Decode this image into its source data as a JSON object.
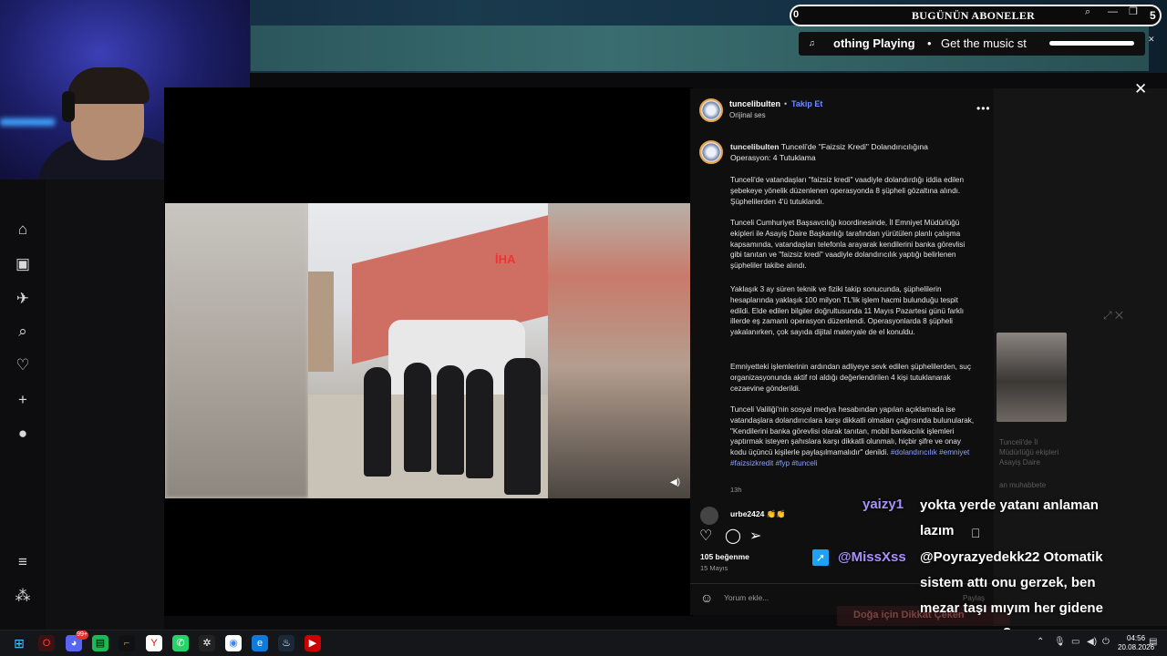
{
  "overlay": {
    "subs_label": "BUGÜNÜN ABONELER",
    "subs_count": "0",
    "subs_right": "5",
    "now_playing": "othing Playing",
    "now_playing_marquee": "Get the music st",
    "np_bullet": "•"
  },
  "post": {
    "username": "tuncelibulten",
    "follow": "Takip Et",
    "audio": "Orijinal ses",
    "caption_user": "tuncelibulten",
    "caption_title": "Tunceli'de \"Faizsiz Kredi\" Dolandırıcılığına Operasyon: 4 Tutuklama",
    "paragraphs": [
      "Tunceli'de vatandaşları \"faizsiz kredi\" vaadiyle dolandırdığı iddia edilen şebekeye yönelik düzenlenen operasyonda 8 şüpheli gözaltına alındı. Şüphelilerden 4'ü tutuklandı.",
      "Tunceli Cumhuriyet Başsavcılığı koordinesinde, İl Emniyet Müdürlüğü ekipleri ile Asayiş Daire Başkanlığı tarafından yürütülen planlı çalışma kapsamında, vatandaşları telefonla arayarak kendilerini banka görevlisi gibi tanıtan ve \"faizsiz kredi\" vaadiyle dolandırıcılık yaptığı belirlenen şüpheliler takibe alındı.",
      "Yaklaşık 3 ay süren teknik ve fiziki takip sonucunda, şüphelilerin hesaplarında yaklaşık 100 milyon TL'lik işlem hacmi bulunduğu tespit edildi. Elde edilen bilgiler doğrultusunda 11 Mayıs Pazartesi günü farklı illerde eş zamanlı operasyon düzenlendi. Operasyonlarda 8 şüpheli yakalanırken, çok sayıda dijital materyale de el konuldu.",
      "Emniyetteki işlemlerinin ardından adliyeye sevk edilen şüphelilerden, suç organizasyonunda aktif rol aldığı değerlendirilen 4 kişi tutuklanarak cezaevine gönderildi."
    ],
    "last_paragraph": "Tunceli Valiliği'nin sosyal medya hesabından yapılan açıklamada ise vatandaşlara dolandırıcılara karşı dikkatli olmaları çağrısında bulunularak, \"Kendilerini banka görevlisi olarak tanıtan, mobil bankacılık işlemleri yaptırmak isteyen şahıslara karşı dikkatli olunmalı, hiçbir şifre ve onay kodu üçüncü kişilerle paylaşılmamalıdır\" denildi.",
    "hashtags": "#dolandırıcılık #emniyet #faizsizkredit #fyp #tunceli",
    "time_ago": "13h",
    "comment_user": "urbe2424",
    "comment_emoji": "👏👏",
    "likes": "105 beğenme",
    "date": "15 Mayıs",
    "comment_placeholder": "Yorum ekle...",
    "watermark": "İHA"
  },
  "side_faded": {
    "line1": "Tunceli'de İl",
    "line2": "Müdürlüğü ekipleri",
    "line3": "Asayiş Daire",
    "line4": "an muhabbete",
    "share": "Paylaş",
    "banner": "Doğa için Dikkat Çeken"
  },
  "chat": {
    "m1_user": "yaizy1",
    "m1_line1": "yokta yerde yatanı anlaman",
    "m1_line2": "lazım",
    "m2_user": "@MissXss",
    "m2_line1": "@Poyrazyedekk22 Otomatik",
    "m2_line2": "sistem attı onu gerzek, ben",
    "m2_line3": "mezar taşı mıyım her gidene",
    "m2_line4": "yazı yazayım?"
  },
  "taskbar": {
    "time": "04:56",
    "date": "20.08.2026",
    "badge": "99+"
  },
  "colors": {
    "accent": "#6e8dff",
    "chat_name": "#a890ff",
    "hashtag": "#8aa4ff"
  }
}
